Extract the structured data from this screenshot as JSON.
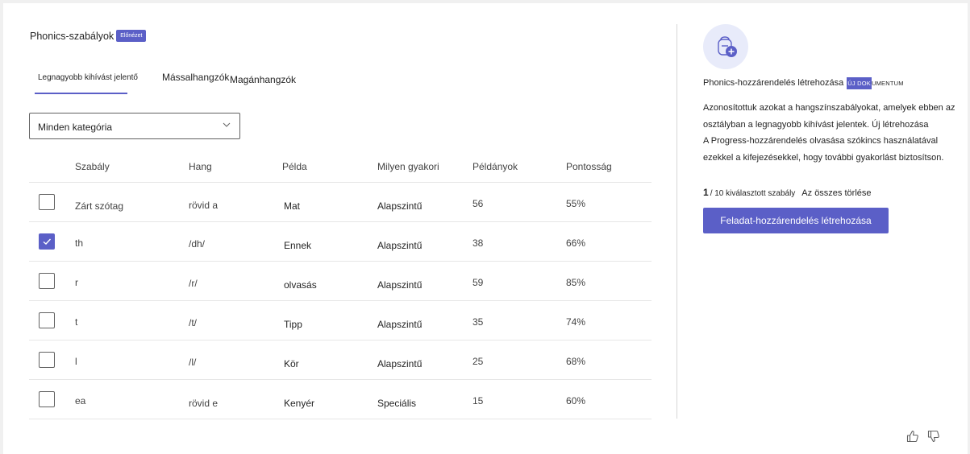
{
  "header": {
    "title": "Phonics-szabályok",
    "badge": "Előnézet"
  },
  "tabs": [
    {
      "label": "Legnagyobb kihívást jelentő",
      "selected": true
    },
    {
      "label": "Mássalhangzók",
      "selected": false
    },
    {
      "label": "Magánhangzók",
      "selected": false
    }
  ],
  "filter": {
    "value": "Minden kategória",
    "icon": "chevron-down-icon"
  },
  "table": {
    "columns": [
      "Szabály",
      "Hang",
      "Példa",
      "Milyen gyakori",
      "Példányok",
      "Pontosság"
    ],
    "rows": [
      {
        "checked": false,
        "rule": "Zárt szótag",
        "sound": "rövid a",
        "example": "Mat",
        "frequency": "Alapszintű",
        "count": "56",
        "accuracy": "55%"
      },
      {
        "checked": true,
        "rule": "th",
        "sound": "/dh/",
        "example": "Ennek",
        "frequency": "Alapszintű",
        "count": "38",
        "accuracy": "66%"
      },
      {
        "checked": false,
        "rule": "r",
        "sound": "/r/",
        "example": "olvasás",
        "frequency": "Alapszintű",
        "count": "59",
        "accuracy": "85%"
      },
      {
        "checked": false,
        "rule": "t",
        "sound": "/t/",
        "example": "Tipp",
        "frequency": "Alapszintű",
        "count": "35",
        "accuracy": "74%"
      },
      {
        "checked": false,
        "rule": "l",
        "sound": "/l/",
        "example": "Kör",
        "frequency": "Alapszintű",
        "count": "25",
        "accuracy": "68%"
      },
      {
        "checked": false,
        "rule": "ea",
        "sound": "rövid e",
        "example": "Kenyér",
        "frequency": "Speciális",
        "count": "15",
        "accuracy": "60%"
      }
    ]
  },
  "side_panel": {
    "icon": "backpack-add-icon",
    "title": "Phonics-hozzárendelés létrehozása",
    "badge_highlight": "ÚJ DOK",
    "badge_rest": "UMENTUM",
    "description": [
      "Azonosítottuk azokat a hangszínszabályokat, amelyek ebben az",
      "osztályban a legnagyobb kihívást jelentek. Új létrehozása",
      "A Progress-hozzárendelés olvasása szókincs használatával",
      "ezekkel a kifejezésekkel, hogy további gyakorlást biztosítson."
    ],
    "selected_count": "1",
    "selected_rest": "/ 10 kiválasztott szabály",
    "clear_label": "Az összes törlése",
    "create_button": "Feladat-hozzárendelés létrehozása"
  },
  "feedback": {
    "like_icon": "thumbs-up-icon",
    "dislike_icon": "thumbs-down-icon"
  },
  "colors": {
    "accent": "#5b5fc7",
    "avatar_bg": "#e8ebfa"
  }
}
